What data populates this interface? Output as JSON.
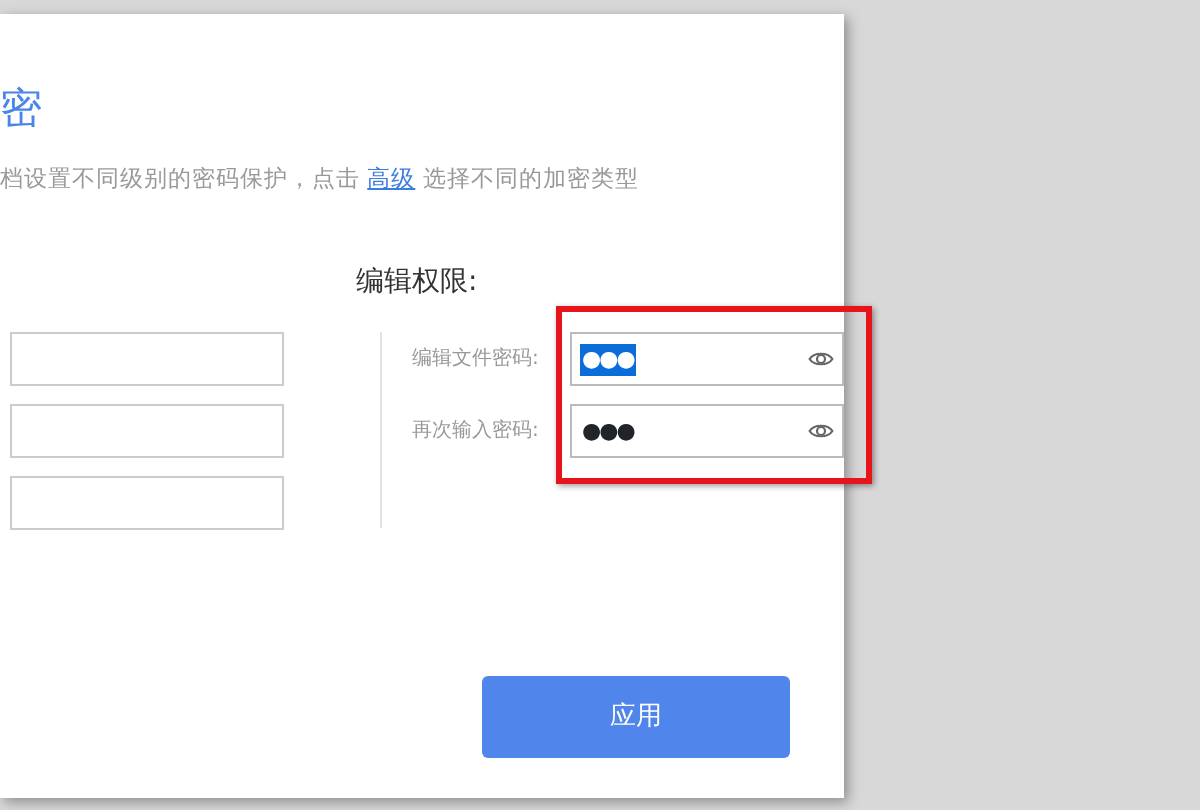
{
  "dialog": {
    "title": "密",
    "description": {
      "before": "档设置不同级别的密码保护，点击 ",
      "link": "高级",
      "after": " 选择不同的加密类型"
    }
  },
  "left_fields": [
    {
      "kind": "input"
    },
    {
      "kind": "input"
    },
    {
      "kind": "input"
    }
  ],
  "edit_permission": {
    "heading": "编辑权限:",
    "fields": [
      {
        "label": "编辑文件密码:",
        "value": "●●●",
        "highlighted": true
      },
      {
        "label": "再次输入密码:",
        "value": "●●●",
        "highlighted": false
      }
    ]
  },
  "annotation": {
    "kind": "highlight-box",
    "color": "#e8141b"
  },
  "buttons": [
    {
      "label": "应用"
    }
  ]
}
